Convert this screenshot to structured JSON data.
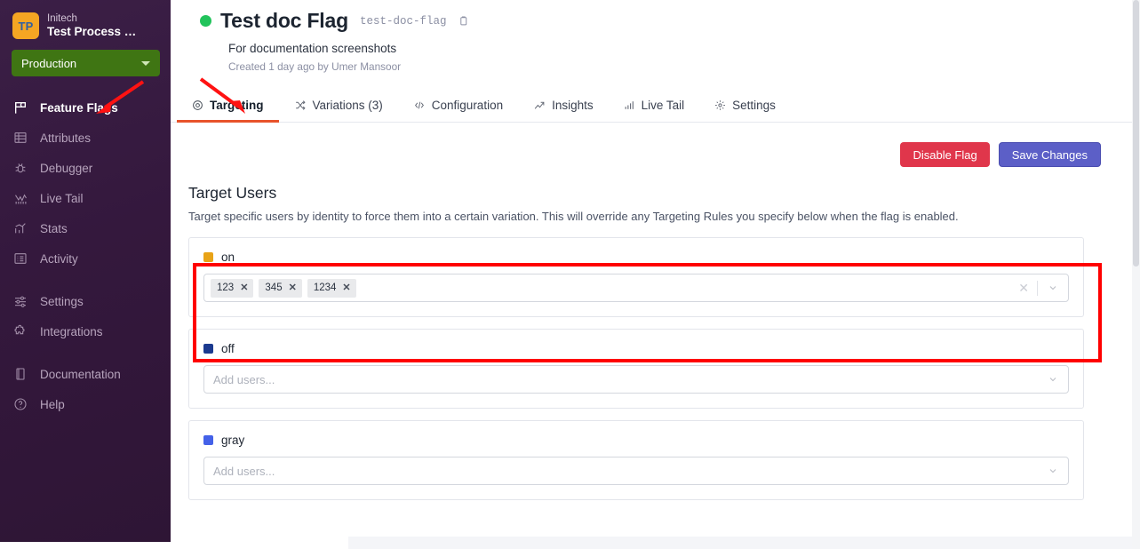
{
  "sidebar": {
    "brand": {
      "logo_initials": "TP",
      "org": "Initech",
      "project": "Test Process …"
    },
    "environment": {
      "label": "Production",
      "caret_icon": "chevron-down-icon"
    },
    "items": [
      {
        "label": "Feature Flags",
        "icon": "flag-icon",
        "active": true
      },
      {
        "label": "Attributes",
        "icon": "attributes-grid-icon",
        "active": false
      },
      {
        "label": "Debugger",
        "icon": "bug-icon",
        "active": false
      },
      {
        "label": "Live Tail",
        "icon": "pulse-icon",
        "active": false
      },
      {
        "label": "Stats",
        "icon": "bar-chart-icon",
        "active": false
      },
      {
        "label": "Activity",
        "icon": "list-icon",
        "active": false
      },
      {
        "label": "Settings",
        "icon": "sliders-icon",
        "active": false
      },
      {
        "label": "Integrations",
        "icon": "puzzle-icon",
        "active": false
      },
      {
        "label": "Documentation",
        "icon": "book-icon",
        "active": false
      },
      {
        "label": "Help",
        "icon": "question-circle-icon",
        "active": false
      }
    ]
  },
  "header": {
    "status_dot": "enabled-green-dot",
    "title": "Test doc Flag",
    "flag_key": "test-doc-flag",
    "copy_icon": "copy-icon",
    "description": "For documentation screenshots",
    "meta": "Created 1 day ago by Umer Mansoor"
  },
  "tabs": [
    {
      "label": "Targeting",
      "icon": "target-icon",
      "active": true
    },
    {
      "label": "Variations (3)",
      "icon": "shuffle-icon",
      "active": false
    },
    {
      "label": "Configuration",
      "icon": "code-icon",
      "active": false
    },
    {
      "label": "Insights",
      "icon": "line-chart-icon",
      "active": false
    },
    {
      "label": "Live Tail",
      "icon": "bars-icon",
      "active": false
    },
    {
      "label": "Settings",
      "icon": "gear-icon",
      "active": false
    }
  ],
  "actions": {
    "disable_label": "Disable Flag",
    "save_label": "Save Changes"
  },
  "target_users": {
    "title": "Target Users",
    "description": "Target specific users by identity to force them into a certain variation. This will override any Targeting Rules you specify below when the flag is enabled.",
    "variations": [
      {
        "name": "on",
        "swatch_color": "#e8a317",
        "tags": [
          "123",
          "345",
          "1234"
        ],
        "placeholder": "",
        "has_clear": true,
        "clear_icon": "clear-x-icon",
        "caret_icon": "chevron-down-icon",
        "highlighted": true
      },
      {
        "name": "off",
        "swatch_color": "#1b3a8f",
        "tags": [],
        "placeholder": "Add users...",
        "has_clear": false,
        "clear_icon": "clear-x-icon",
        "caret_icon": "chevron-down-icon",
        "highlighted": false
      },
      {
        "name": "gray",
        "swatch_color": "#4461e8",
        "tags": [],
        "placeholder": "Add users...",
        "has_clear": false,
        "clear_icon": "clear-x-icon",
        "caret_icon": "chevron-down-icon",
        "highlighted": false
      }
    ]
  },
  "annotations": {
    "highlight_color": "#ff0000",
    "arrows": [
      {
        "name": "arrow-to-feature-flags",
        "points_to": "Feature Flags"
      },
      {
        "name": "arrow-to-targeting-tab",
        "points_to": "Targeting"
      }
    ]
  },
  "colors": {
    "sidebar_bg": "#34183d",
    "env_green": "#3f7513",
    "accent_tab": "#e8532b",
    "danger": "#e0364b",
    "primary": "#5c5fc7",
    "status_green": "#21c35b"
  }
}
